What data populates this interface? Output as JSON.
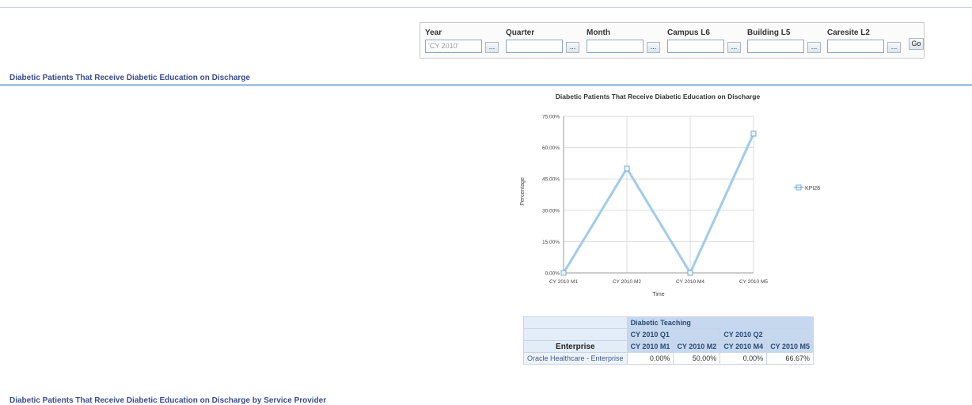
{
  "prompts": {
    "fields": [
      {
        "label": "Year",
        "value": "'CY 2010'",
        "button": "..."
      },
      {
        "label": "Quarter",
        "value": "",
        "button": "..."
      },
      {
        "label": "Month",
        "value": "",
        "button": "..."
      },
      {
        "label": "Campus L6",
        "value": "",
        "button": "..."
      },
      {
        "label": "Building L5",
        "value": "",
        "button": "..."
      },
      {
        "label": "Caresite L2",
        "value": "",
        "button": "..."
      }
    ],
    "go_label": "Go"
  },
  "section1": {
    "title": "Diabetic Patients That Receive Diabetic Education on Discharge"
  },
  "section2": {
    "title": "Diabetic Patients That Receive Diabetic Education on Discharge by Service Provider"
  },
  "colors": {
    "series": "#9fcbed",
    "accent_title": "#3a4b8c",
    "rule": "#a9c4e4"
  },
  "chart_data": {
    "type": "line",
    "title": "Diabetic Patients That Receive Diabetic Education on Discharge",
    "xlabel": "Time",
    "ylabel": "Percentage",
    "categories": [
      "CY 2010 M1",
      "CY 2010 M2",
      "CY 2010 M4",
      "CY 2010 M5"
    ],
    "series": [
      {
        "name": "KPI28",
        "values": [
          0.0,
          50.0,
          0.0,
          66.67
        ]
      }
    ],
    "ylim": [
      0,
      75
    ],
    "yticks": [
      "0.00%",
      "15.00%",
      "30.00%",
      "45.00%",
      "60.00%",
      "75.00%"
    ],
    "grid": true,
    "legend": "right"
  },
  "pivot": {
    "measure": "Diabetic Teaching",
    "quarters": [
      "CY 2010 Q1",
      "CY 2010 Q2"
    ],
    "row_header": "Enterprise",
    "months": [
      "CY 2010 M1",
      "CY 2010 M2",
      "CY 2010 M4",
      "CY 2010 M5"
    ],
    "rows": [
      {
        "label": "Oracle Healthcare - Enterprise",
        "values": [
          "0.00%",
          "50.00%",
          "0.00%",
          "66.67%"
        ]
      }
    ]
  }
}
